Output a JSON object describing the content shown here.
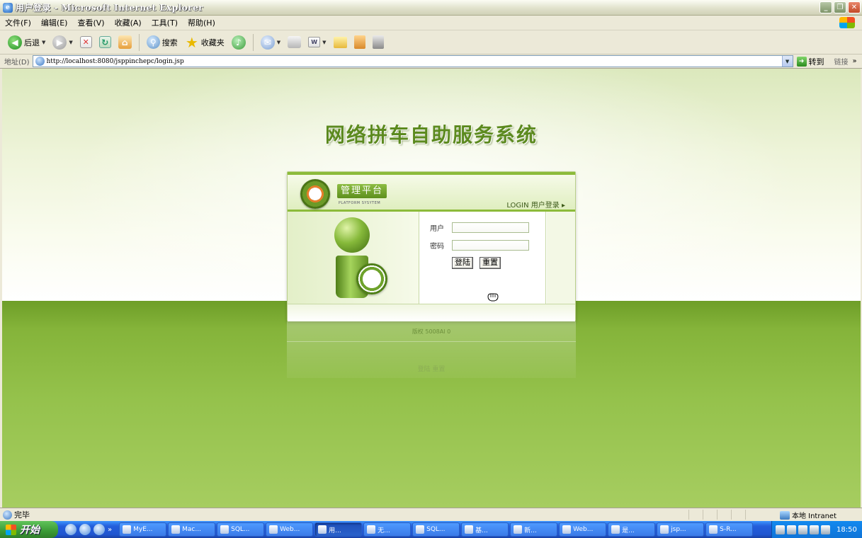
{
  "window": {
    "title": "用户登录 - Microsoft Internet Explorer",
    "app_icon": "ie-icon"
  },
  "menu": [
    "文件(F)",
    "编辑(E)",
    "查看(V)",
    "收藏(A)",
    "工具(T)",
    "帮助(H)"
  ],
  "toolbar": {
    "back_label": "后退",
    "search_label": "搜索",
    "favorites_label": "收藏夹"
  },
  "address": {
    "label": "地址(D)",
    "url": "http://localhost:8080/jsppinchepc/login.jsp",
    "go_label": "转到",
    "links_label": "链接"
  },
  "page": {
    "system_title": "网络拼车自助服务系统",
    "platform_title": "管理平台",
    "platform_subtitle": "PLATFORM SYSYTEM",
    "login_link": "LOGIN 用户登录 ▸",
    "user_label": "用户",
    "user_value": "",
    "password_label": "密码",
    "password_value": "",
    "login_button": "登陆",
    "reset_button": "重置",
    "copyright": "版权 5008AI 0",
    "reflection_text": "登陆 重置"
  },
  "status": {
    "text": "完毕",
    "zone": "本地 Intranet"
  },
  "taskbar": {
    "start_label": "开始",
    "tasks": [
      {
        "label": "MyE...",
        "active": false
      },
      {
        "label": "Mac...",
        "active": false
      },
      {
        "label": "SQL...",
        "active": false
      },
      {
        "label": "Web...",
        "active": false
      },
      {
        "label": "用...",
        "active": true
      },
      {
        "label": "无...",
        "active": false
      },
      {
        "label": "SQL...",
        "active": false
      },
      {
        "label": "基...",
        "active": false
      },
      {
        "label": "新...",
        "active": false
      },
      {
        "label": "Web...",
        "active": false
      },
      {
        "label": "是...",
        "active": false
      },
      {
        "label": "jsp...",
        "active": false
      },
      {
        "label": "S-R...",
        "active": false
      }
    ],
    "clock": "18:50"
  }
}
